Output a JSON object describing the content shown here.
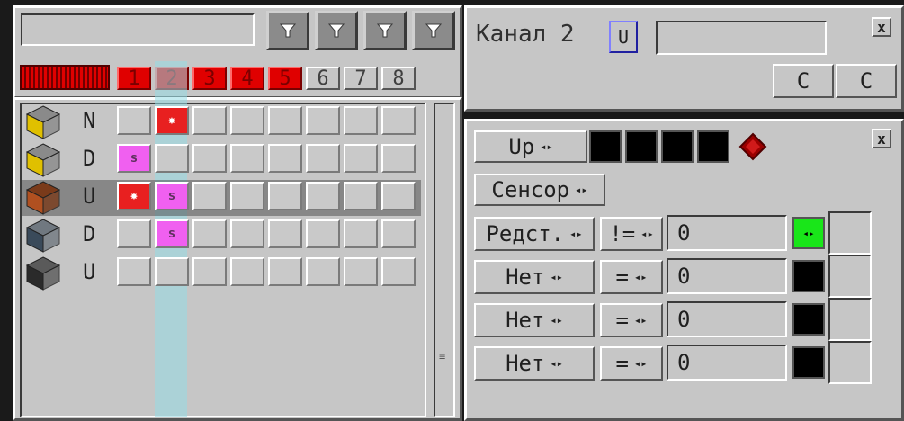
{
  "left": {
    "name_field_value": "",
    "filters": [
      "filter-icon",
      "filter-icon",
      "filter-icon",
      "filter-icon"
    ],
    "channel_tabs": [
      {
        "label": "1",
        "active": true
      },
      {
        "label": "2",
        "active": true
      },
      {
        "label": "3",
        "active": true
      },
      {
        "label": "4",
        "active": true
      },
      {
        "label": "5",
        "active": true
      },
      {
        "label": "6",
        "active": false
      },
      {
        "label": "7",
        "active": false
      },
      {
        "label": "8",
        "active": false
      }
    ],
    "rows": [
      {
        "icon": "nuclear-reactor-icon",
        "label": "N",
        "marks": [
          "",
          "spark",
          "",
          "",
          "",
          "",
          "",
          ""
        ]
      },
      {
        "icon": "nuclear-reactor-icon",
        "label": "D",
        "marks": [
          "s",
          "",
          "",
          "",
          "",
          "",
          "",
          ""
        ]
      },
      {
        "icon": "redstone-lamp-icon",
        "label": "U",
        "marks": [
          "spark",
          "s",
          "",
          "",
          "",
          "",
          "",
          ""
        ]
      },
      {
        "icon": "machine-block-icon",
        "label": "D",
        "marks": [
          "",
          "s",
          "",
          "",
          "",
          "",
          "",
          ""
        ]
      },
      {
        "icon": "computer-block-icon",
        "label": "U",
        "marks": [
          "",
          "",
          "",
          "",
          "",
          "",
          "",
          ""
        ]
      }
    ]
  },
  "channel_panel": {
    "title": "Канал 2",
    "toggle_label": "U",
    "name_value": "",
    "btn1": "C",
    "btn2": "C",
    "close": "x"
  },
  "logic_panel": {
    "close": "x",
    "direction_label": "Up",
    "sensor_label": "Сенсор",
    "rows": [
      {
        "source": "Редст.",
        "op": "!=",
        "value": "0",
        "out_color": "#19e619",
        "out_on": true
      },
      {
        "source": "Нет",
        "op": "=",
        "value": "0",
        "out_color": "#000000",
        "out_on": false
      },
      {
        "source": "Нет",
        "op": "=",
        "value": "0",
        "out_color": "#000000",
        "out_on": false
      },
      {
        "source": "Нет",
        "op": "=",
        "value": "0",
        "out_color": "#000000",
        "out_on": false
      }
    ],
    "arrow_glyph": "◂▸"
  }
}
